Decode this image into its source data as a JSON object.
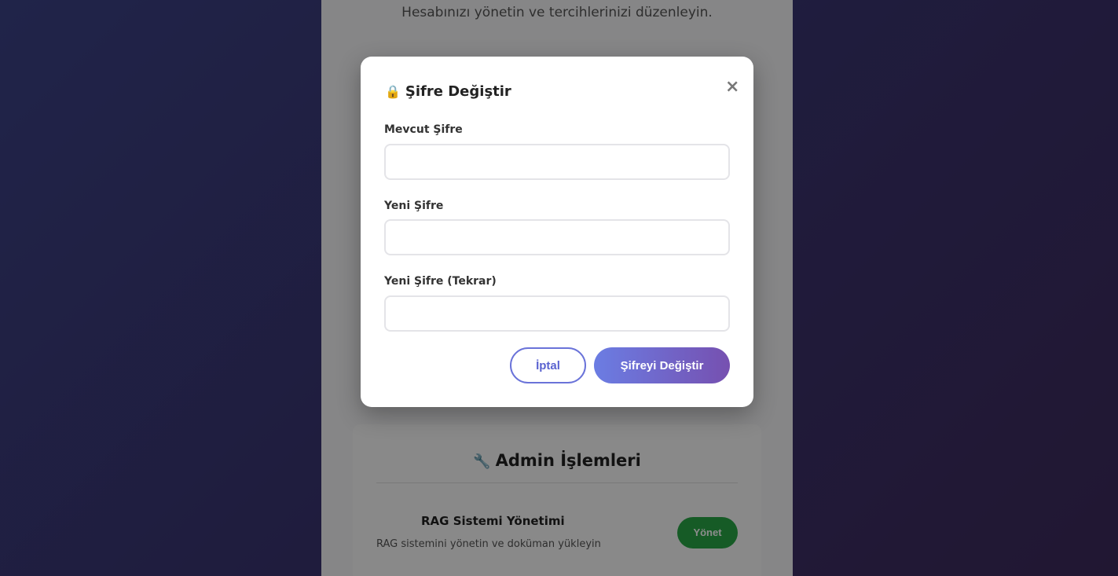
{
  "background_page": {
    "subtitle": "Hesabınızı yönetin ve tercihlerinizi düzenleyin.",
    "admin": {
      "icon": "wrench-icon",
      "title": "Admin İşlemleri",
      "rag_title": "RAG Sistemi Yönetimi",
      "rag_description": "RAG sistemini yönetin ve doküman yükleyin",
      "manage_label": "Yönet"
    }
  },
  "modal": {
    "icon": "lock-icon",
    "title": "Şifre Değiştir",
    "close_label": "×",
    "fields": [
      {
        "label": "Mevcut Şifre",
        "value": "",
        "placeholder": ""
      },
      {
        "label": "Yeni Şifre",
        "value": "",
        "placeholder": ""
      },
      {
        "label": "Yeni Şifre (Tekrar)",
        "value": "",
        "placeholder": ""
      }
    ],
    "cancel_label": "İptal",
    "submit_label": "Şifreyi Değiştir"
  },
  "colors": {
    "accent": "#6a73d9",
    "gradient_start": "#6b7de3",
    "gradient_end": "#7650b0",
    "success": "#28a745"
  }
}
